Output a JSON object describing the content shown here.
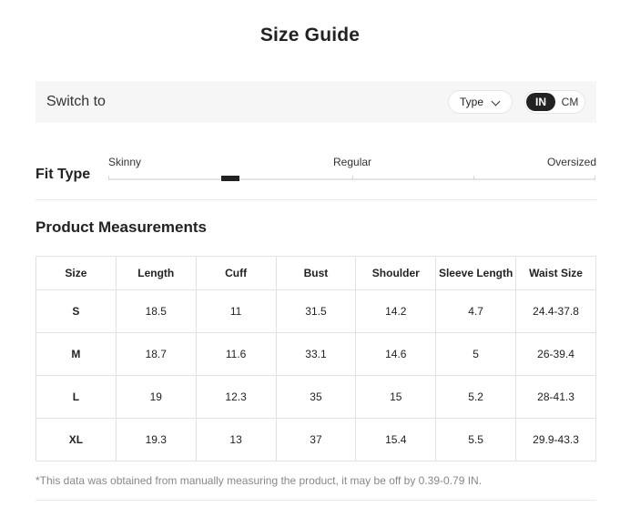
{
  "title": "Size Guide",
  "switch": {
    "label": "Switch to",
    "type_label": "Type",
    "units": [
      "IN",
      "CM"
    ],
    "selected_unit": "IN"
  },
  "fit": {
    "label": "Fit Type",
    "options": [
      "Skinny",
      "Regular",
      "Oversized"
    ],
    "marker_position": 0.25
  },
  "measurements": {
    "title": "Product Measurements",
    "columns": [
      "Size",
      "Length",
      "Cuff",
      "Bust",
      "Shoulder",
      "Sleeve Length",
      "Waist Size"
    ],
    "rows": [
      [
        "S",
        "18.5",
        "11",
        "31.5",
        "14.2",
        "4.7",
        "24.4-37.8"
      ],
      [
        "M",
        "18.7",
        "11.6",
        "33.1",
        "14.6",
        "5",
        "26-39.4"
      ],
      [
        "L",
        "19",
        "12.3",
        "35",
        "15",
        "5.2",
        "28-41.3"
      ],
      [
        "XL",
        "19.3",
        "13",
        "37",
        "15.4",
        "5.5",
        "29.9-43.3"
      ]
    ]
  },
  "note": "*This data was obtained from manually measuring the product, it may be off by 0.39-0.79 IN.",
  "colors": {
    "accent": "#222222",
    "panel": "#f6f6f6",
    "border": "#e2e2e2"
  }
}
